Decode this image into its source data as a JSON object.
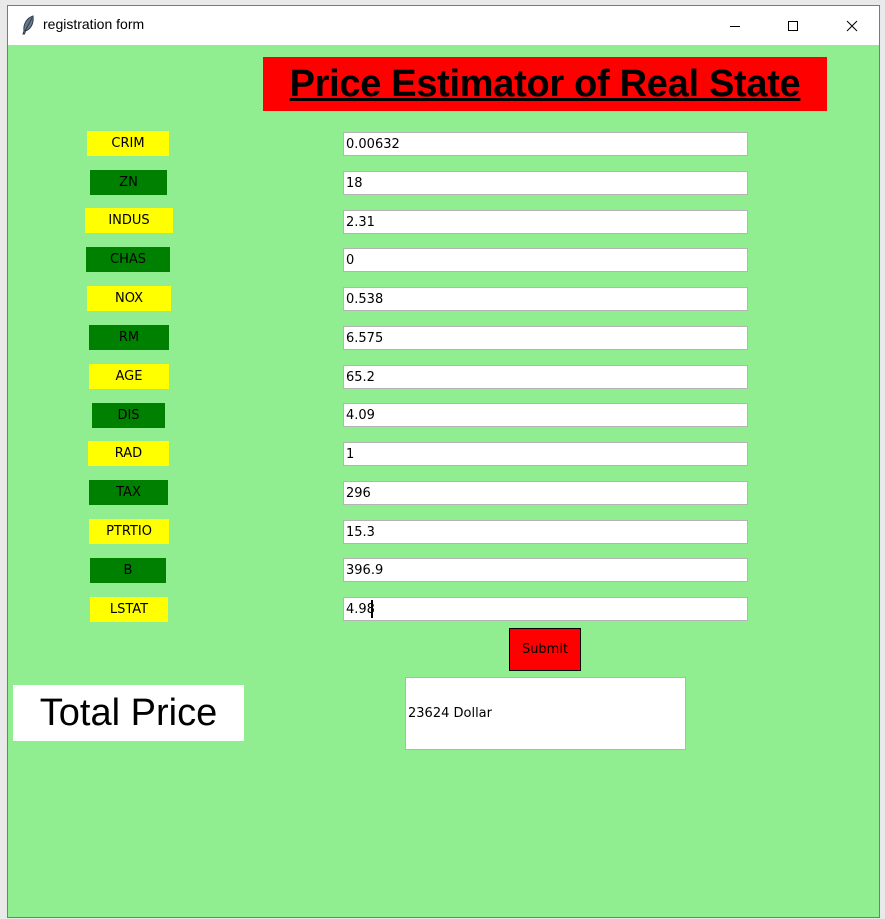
{
  "window": {
    "title": "registration form",
    "icon": "feather-icon",
    "controls": [
      "minimize-icon",
      "maximize-icon",
      "close-icon"
    ]
  },
  "heading": "Price Estimator of Real State",
  "features": [
    {
      "label": "CRIM",
      "value": "0.00632",
      "color": "yellow"
    },
    {
      "label": "ZN",
      "value": "18",
      "color": "green"
    },
    {
      "label": "INDUS",
      "value": "2.31",
      "color": "yellow"
    },
    {
      "label": "CHAS",
      "value": "0",
      "color": "green"
    },
    {
      "label": "NOX",
      "value": "0.538",
      "color": "yellow"
    },
    {
      "label": "RM",
      "value": "6.575",
      "color": "green"
    },
    {
      "label": "AGE",
      "value": "65.2",
      "color": "yellow"
    },
    {
      "label": "DIS",
      "value": "4.09",
      "color": "green"
    },
    {
      "label": "RAD",
      "value": "1",
      "color": "yellow"
    },
    {
      "label": "TAX",
      "value": "296",
      "color": "green"
    },
    {
      "label": "PTRTIO",
      "value": "15.3",
      "color": "yellow"
    },
    {
      "label": "B",
      "value": "396.9",
      "color": "green"
    },
    {
      "label": "LSTAT",
      "value": "4.98",
      "color": "yellow"
    }
  ],
  "submit_label": "Submit",
  "total_label": "Total Price",
  "result_text": "23624 Dollar",
  "colors": {
    "background": "#90ee90",
    "heading_bg": "#ff0000",
    "label_yellow": "#ffff00",
    "label_green": "#008000",
    "submit_bg": "#ff0000"
  }
}
